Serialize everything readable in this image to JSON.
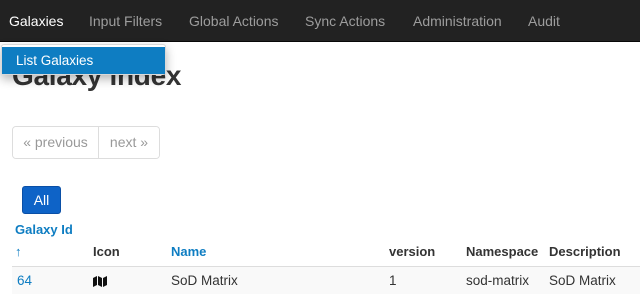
{
  "navbar": {
    "items": [
      {
        "label": "Galaxies"
      },
      {
        "label": "Input Filters"
      },
      {
        "label": "Global Actions"
      },
      {
        "label": "Sync Actions"
      },
      {
        "label": "Administration"
      },
      {
        "label": "Audit"
      }
    ]
  },
  "dropdown": {
    "items": [
      {
        "label": "List Galaxies"
      }
    ]
  },
  "page": {
    "title": "Galaxy index"
  },
  "pagination": {
    "previous_label": "« previous",
    "next_label": "next »"
  },
  "filter": {
    "all_label": "All"
  },
  "table": {
    "headers": {
      "galaxy_id": "Galaxy Id",
      "sort_indicator": "↑",
      "icon": "Icon",
      "name": "Name",
      "version": "version",
      "namespace": "Namespace",
      "description": "Description"
    },
    "rows": [
      {
        "galaxy_id": "64",
        "icon": "map-icon",
        "name": "SoD Matrix",
        "version": "1",
        "namespace": "sod-matrix",
        "description": "SoD Matrix"
      }
    ]
  },
  "colors": {
    "navbar_bg": "#222222",
    "link": "#0e7dc2",
    "primary_button": "#0e63c7"
  }
}
